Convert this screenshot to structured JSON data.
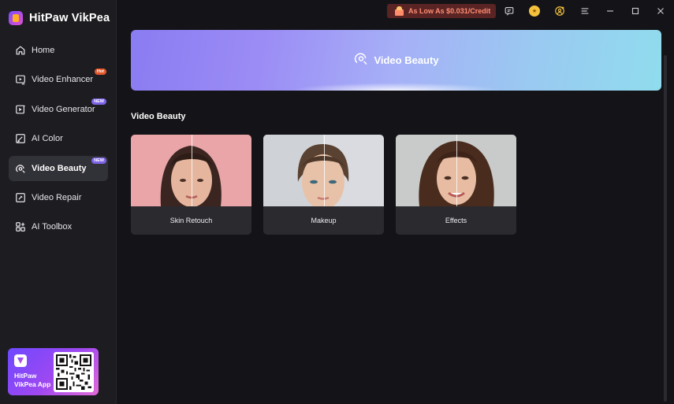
{
  "app": {
    "title": "HitPaw VikPea"
  },
  "sidebar": {
    "items": [
      {
        "label": "Home",
        "icon": "home-icon",
        "tag": ""
      },
      {
        "label": "Video Enhancer",
        "icon": "video-enhance-icon",
        "tag": "Hot"
      },
      {
        "label": "Video Generator",
        "icon": "video-generator-icon",
        "tag": "NEW"
      },
      {
        "label": "AI Color",
        "icon": "ai-color-icon",
        "tag": ""
      },
      {
        "label": "Video Beauty",
        "icon": "video-beauty-icon",
        "tag": "NEW",
        "active": true
      },
      {
        "label": "Video Repair",
        "icon": "video-repair-icon",
        "tag": ""
      },
      {
        "label": "AI Toolbox",
        "icon": "toolbox-icon",
        "tag": ""
      }
    ],
    "promo": {
      "line1": "HitPaw",
      "line2": "VikPea App"
    }
  },
  "topbar": {
    "credit_text": "As Low As $0.031/Credit",
    "icons": [
      "message-icon",
      "coin-icon",
      "account-icon",
      "menu-icon",
      "minimize-icon",
      "maximize-icon",
      "close-icon"
    ]
  },
  "main": {
    "banner_title": "Video Beauty",
    "section_title": "Video Beauty",
    "cards": [
      {
        "label": "Skin Retouch"
      },
      {
        "label": "Makeup"
      },
      {
        "label": "Effects"
      }
    ]
  },
  "colors": {
    "background": "#141418",
    "sidebar": "#1d1d21",
    "active_item": "#313138",
    "accent_purple": "#7e63e6",
    "hot_tag": "#e2572c",
    "credit_text": "#ff8e73"
  }
}
